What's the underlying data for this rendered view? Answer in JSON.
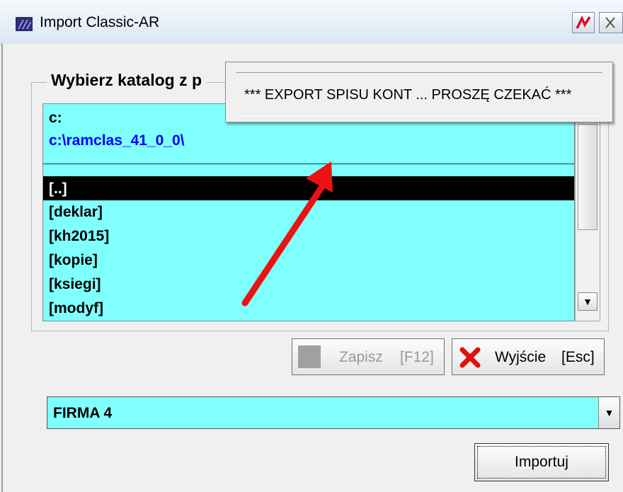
{
  "window": {
    "title": "Import Classic-AR"
  },
  "icons": {
    "app": "app-logo-icon",
    "help": "help-pen-icon",
    "close": "close-icon",
    "save": "save-square-icon",
    "exit": "red-x-icon",
    "scroll_down": "chevron-down-icon"
  },
  "group": {
    "title": "Wybierz katalog z p"
  },
  "list": {
    "drive": "c:",
    "path": "c:\\ramclas_41_0_0\\",
    "items": [
      "[..]",
      "[deklar]",
      "[kh2015]",
      "[kopie]",
      "[ksiegi]",
      "[modyf]"
    ],
    "selected_index": 0
  },
  "popup": {
    "message": "*** EXPORT SPISU KONT ... PROSZĘ CZEKAĆ ***"
  },
  "buttons": {
    "save_label": "Zapisz",
    "save_key": "[F12]",
    "exit_label": "Wyjście",
    "exit_key": "[Esc]",
    "import_label": "Importuj"
  },
  "company_select": {
    "value": "FIRMA 4"
  },
  "colors": {
    "list_bg": "#80ffff",
    "path_text": "#0000ff",
    "arrow": "#ee1111"
  }
}
